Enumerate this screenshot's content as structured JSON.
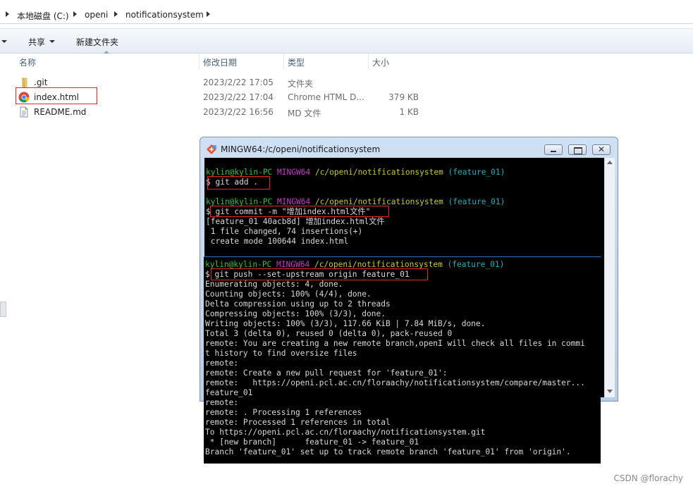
{
  "address_bar": {
    "segments": [
      "本地磁盘 (C:)",
      "openi",
      "notificationsystem"
    ]
  },
  "toolbar": {
    "share_label": "共享",
    "new_folder_label": "新建文件夹"
  },
  "columns": {
    "name": "名称",
    "modified": "修改日期",
    "type": "类型",
    "size": "大小"
  },
  "files": [
    {
      "name": ".git",
      "modified": "2023/2/22 17:05",
      "type": "文件夹",
      "size": "",
      "icon": "folder-icon"
    },
    {
      "name": "index.html",
      "modified": "2023/2/22 17:04",
      "type": "Chrome HTML D...",
      "size": "379 KB",
      "icon": "chrome-icon"
    },
    {
      "name": "README.md",
      "modified": "2023/2/22 16:56",
      "type": "MD 文件",
      "size": "1 KB",
      "icon": "document-icon"
    }
  ],
  "terminal": {
    "title": "MINGW64:/c/openi/notificationsystem",
    "prompt": {
      "user": "kylin@kylin-PC",
      "shell": "MINGW64",
      "path": "/c/openi/notificationsystem",
      "branch": "(feature_01)"
    },
    "cmd_add": "$ git add .",
    "cmd_commit": "$ git commit -m \"增加index.html文件\"",
    "commit_out": [
      "[feature_01 40acb8d] 增加index.html文件",
      " 1 file changed, 74 insertions(+)",
      " create mode 100644 index.html"
    ],
    "cmd_push": "$ git push --set-upstream origin feature_01",
    "push_out": [
      "Enumerating objects: 4, done.",
      "Counting objects: 100% (4/4), done.",
      "Delta compression using up to 2 threads",
      "Compressing objects: 100% (3/3), done.",
      "Writing objects: 100% (3/3), 117.66 KiB | 7.84 MiB/s, done.",
      "Total 3 (delta 0), reused 0 (delta 0), pack-reused 0",
      "remote: You are creating a new remote branch,openI will check all files in commi",
      "t history to find oversize files",
      "remote:",
      "remote: Create a new pull request for 'feature_01':",
      "remote:   https://openi.pcl.ac.cn/floraachy/notificationsystem/compare/master...",
      "feature_01",
      "remote:",
      "remote: . Processing 1 references",
      "remote: Processed 1 references in total",
      "To https://openi.pcl.ac.cn/floraachy/notificationsystem.git",
      " * [new branch]      feature_01 -> feature_01",
      "Branch 'feature_01' set up to track remote branch 'feature_01' from 'origin'."
    ]
  },
  "watermark": "CSDN @florachy"
}
